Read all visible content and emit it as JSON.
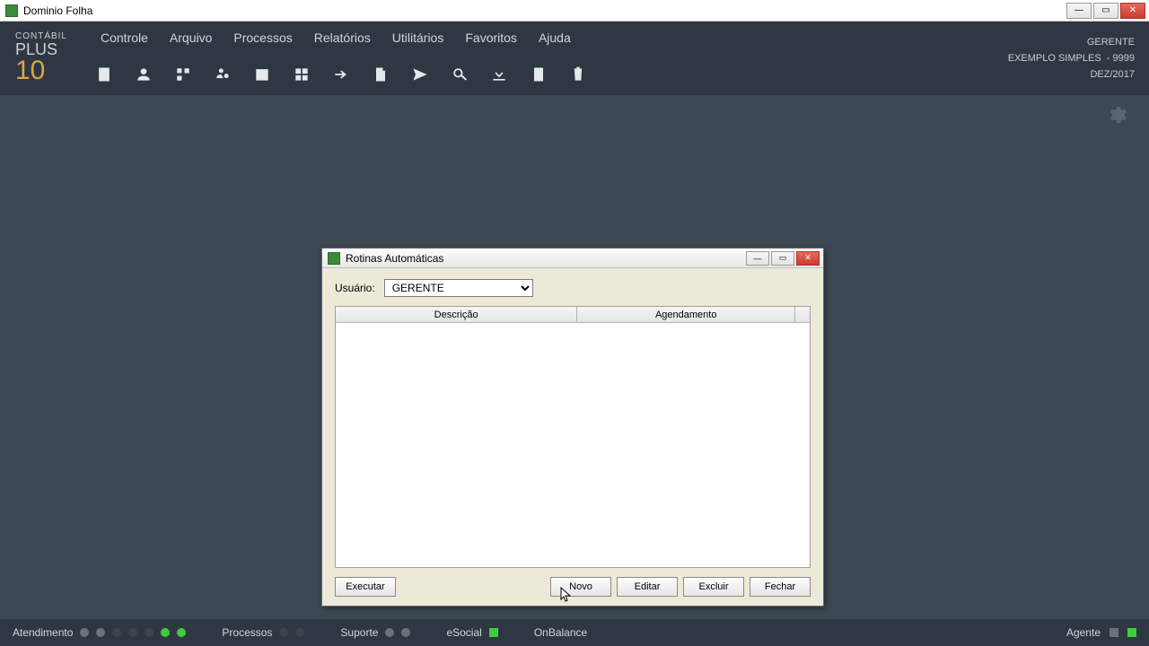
{
  "outer_window": {
    "title": "Dominio Folha"
  },
  "logo": {
    "line1": "CONTÁBIL",
    "line2": "PLUS",
    "line3": "10"
  },
  "menu": [
    "Controle",
    "Arquivo",
    "Processos",
    "Relatórios",
    "Utilitários",
    "Favoritos",
    "Ajuda"
  ],
  "user_block": {
    "role": "GERENTE",
    "company": "EXEMPLO SIMPLES",
    "code": "- 9999",
    "period": "DEZ/2017"
  },
  "dialog": {
    "title": "Rotinas Automáticas",
    "user_label": "Usuário:",
    "user_selected": "GERENTE",
    "columns": {
      "desc": "Descrição",
      "sched": "Agendamento"
    },
    "buttons": {
      "executar": "Executar",
      "novo": "Novo",
      "editar": "Editar",
      "excluir": "Excluir",
      "fechar": "Fechar"
    }
  },
  "statusbar": {
    "atendimento": "Atendimento",
    "processos": "Processos",
    "suporte": "Suporte",
    "esocial": "eSocial",
    "onbalance": "OnBalance",
    "agente": "Agente"
  }
}
